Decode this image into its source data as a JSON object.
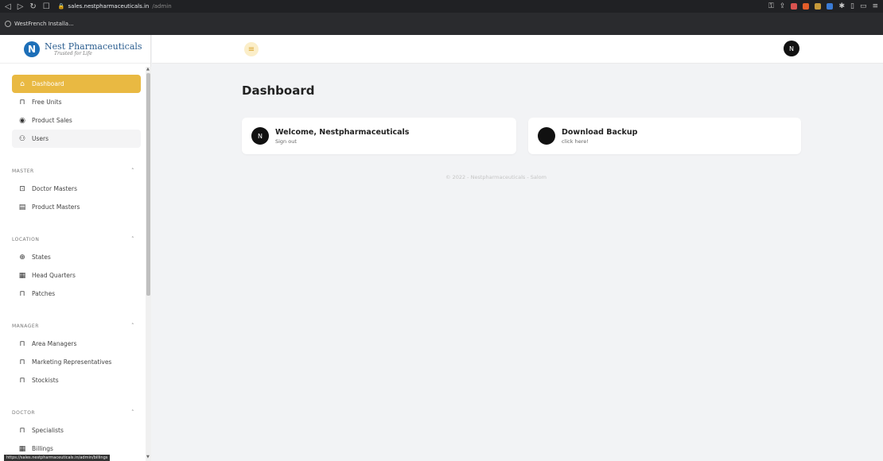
{
  "browser": {
    "url_host": "sales.nestpharmaceuticals.in",
    "url_path": "/admin",
    "bookmark": "WestFrench Installa..."
  },
  "brand": {
    "name": "Nest Pharmaceuticals",
    "tagline": "Trusted for Life",
    "logo_letter": "N"
  },
  "sidebar": {
    "main_items": [
      {
        "label": "Dashboard",
        "icon": "home-icon"
      },
      {
        "label": "Free Units",
        "icon": "lock-icon"
      },
      {
        "label": "Product Sales",
        "icon": "target-icon"
      },
      {
        "label": "Users",
        "icon": "users-icon"
      }
    ],
    "sections": [
      {
        "title": "MASTER",
        "items": [
          {
            "label": "Doctor Masters",
            "icon": "doctor-icon"
          },
          {
            "label": "Product Masters",
            "icon": "box-icon"
          }
        ]
      },
      {
        "title": "LOCATION",
        "items": [
          {
            "label": "States",
            "icon": "globe-icon"
          },
          {
            "label": "Head Quarters",
            "icon": "building-icon"
          },
          {
            "label": "Patches",
            "icon": "lock-icon"
          }
        ]
      },
      {
        "title": "MANAGER",
        "items": [
          {
            "label": "Area Managers",
            "icon": "lock-icon"
          },
          {
            "label": "Marketing Representatives",
            "icon": "lock-icon"
          },
          {
            "label": "Stockists",
            "icon": "lock-icon"
          }
        ]
      },
      {
        "title": "DOCTOR",
        "items": [
          {
            "label": "Specialists",
            "icon": "lock-icon"
          },
          {
            "label": "Billings",
            "icon": "building-icon"
          }
        ]
      }
    ],
    "status_url": "https://sales.nestpharmaceuticals.in/admin/billings"
  },
  "topbar": {
    "avatar_letter": "N"
  },
  "main": {
    "title": "Dashboard",
    "welcome_title": "Welcome, Nestpharmaceuticals",
    "welcome_sub": "Sign out",
    "welcome_avatar": "N",
    "backup_title": "Download Backup",
    "backup_sub": "click here!",
    "footer": "© 2022 - Nestpharmaceuticals - Salom"
  },
  "colors": {
    "accent": "#e9b942",
    "brand": "#1d6fb8"
  }
}
